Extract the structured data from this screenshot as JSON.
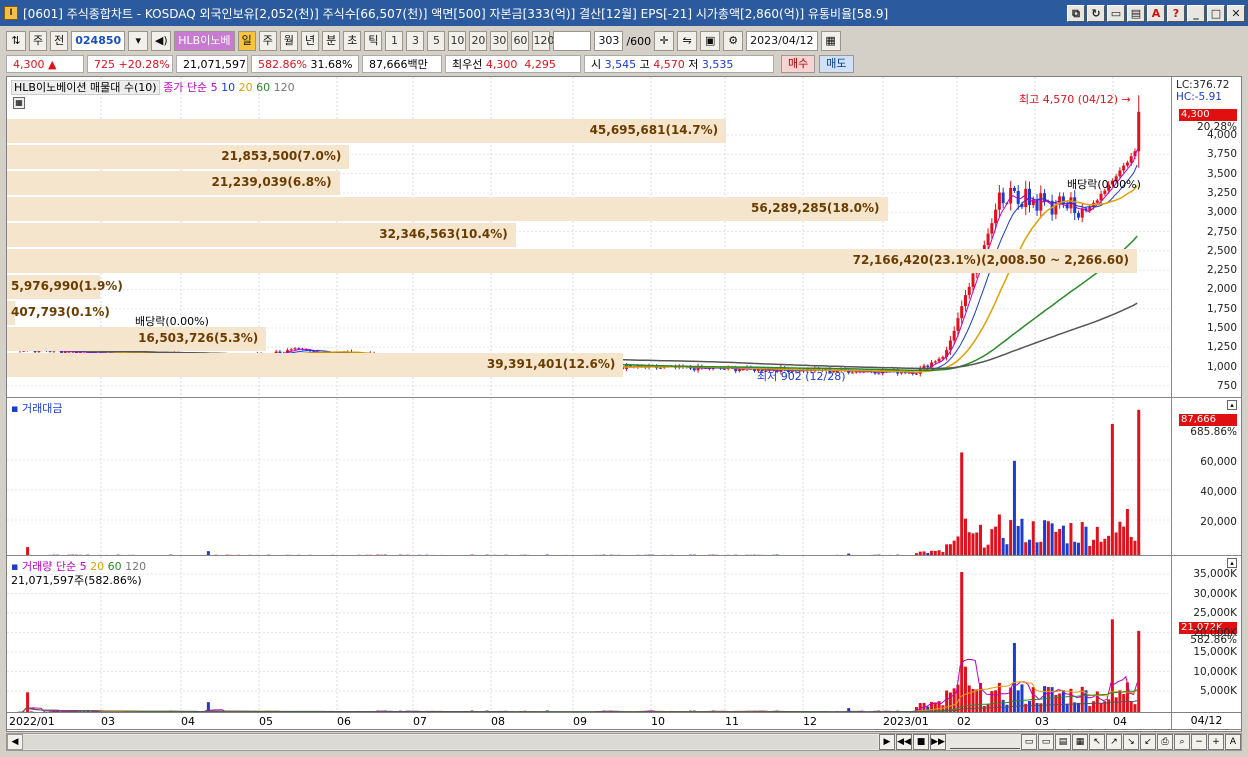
{
  "window": {
    "title": "[0601] 주식종합차트 - KOSDAQ 외국인보유[2,052(천)] 주식수[66,507(천)] 액면[500] 자본금[333(억)] 결산[12월] EPS[-21] 시가총액[2,860(억)] 유통비율[58.9]"
  },
  "toolbar": {
    "period_options": [
      "주",
      "전"
    ],
    "code": "024850",
    "stock_name": "HLB이노베",
    "timeframes": [
      "일",
      "주",
      "월",
      "년",
      "분",
      "초",
      "틱"
    ],
    "intervals": [
      "1",
      "3",
      "5",
      "10",
      "20",
      "30",
      "60",
      "120"
    ],
    "count": "303",
    "count_total": "/600",
    "date": "2023/04/12"
  },
  "quote": {
    "price": "4,300",
    "change": "725",
    "change_pct": "+20.28%",
    "volume": "21,071,597",
    "volume_ratio": "582.86%",
    "turnover": "31.68%",
    "amount": "87,666백만",
    "best_bid_label": "최우선",
    "best_ask": "4,300",
    "best_bid": "4,295",
    "open_label": "시",
    "open": "3,545",
    "high_label": "고",
    "high": "4,570",
    "low_label": "저",
    "low": "3,535",
    "buy_label": "매수",
    "sell_label": "매도"
  },
  "price_pane": {
    "legend_name": "HLB이노베이션 매물대 수(10)",
    "legend_ma": "종가 단순",
    "ma_periods": [
      "5",
      "10",
      "20",
      "60",
      "120"
    ],
    "ma_colors": [
      "#c000c0",
      "#1c3ccf",
      "#e0a000",
      "#2a8a2a",
      "#555555"
    ],
    "lc": "LC:376.72",
    "hc": "HC:-5.91",
    "high_marker": "최고 4,570 (04/12)",
    "low_marker": "최저 902 (12/28)",
    "dividend_label": "배당락(0.00%)",
    "current_price_badge": "4,300",
    "current_change_badge": "20.28%",
    "price_ticks": [
      "4,000",
      "3,750",
      "3,500",
      "3,250",
      "3,000",
      "2,750",
      "2,500",
      "2,250",
      "2,000",
      "1,750",
      "1,500",
      "1,250",
      "1,000",
      "750"
    ],
    "volume_profile": [
      {
        "label": "45,695,681(14.7%)",
        "pct": 14.7
      },
      {
        "label": "21,853,500(7.0%)",
        "pct": 7.0
      },
      {
        "label": "21,239,039(6.8%)",
        "pct": 6.8
      },
      {
        "label": "56,289,285(18.0%)",
        "pct": 18.0
      },
      {
        "label": "32,346,563(10.4%)",
        "pct": 10.4
      },
      {
        "label": "72,166,420(23.1%)(2,008.50 ~ 2,266.60)",
        "pct": 23.1
      },
      {
        "label": "5,976,990(1.9%)",
        "pct": 1.9
      },
      {
        "label": "407,793(0.1%)",
        "pct": 0.1
      },
      {
        "label": "16,503,726(5.3%)",
        "pct": 5.3
      },
      {
        "label": "39,391,401(12.6%)",
        "pct": 12.6
      }
    ]
  },
  "amount_pane": {
    "legend": "거래대금",
    "badge_value": "87,666",
    "badge_pct": "685.86%",
    "ticks": [
      "60,000",
      "40,000",
      "20,000"
    ]
  },
  "volume_pane": {
    "legend_name": "거래량",
    "legend_ma": "단순",
    "ma_periods": [
      "5",
      "20",
      "60",
      "120"
    ],
    "current_volume": "21,071,597주(582.86%)",
    "badge_value": "21,072K",
    "badge_pct": "582.86%",
    "ticks": [
      "35,000K",
      "30,000K",
      "25,000K",
      "20,000K",
      "15,000K",
      "10,000K",
      "5,000K"
    ]
  },
  "date_axis": {
    "labels": [
      "2022/01",
      "03",
      "04",
      "05",
      "06",
      "07",
      "08",
      "09",
      "10",
      "11",
      "12",
      "2023/01",
      "02",
      "03",
      "04"
    ],
    "current": "04/12"
  },
  "chart_data": {
    "type": "candlestick",
    "title": "HLB이노베이션",
    "x_range": [
      "2022/01",
      "2023/04/12"
    ],
    "ylim": [
      750,
      4570
    ],
    "high": {
      "date": "04/12",
      "value": 4570
    },
    "low": {
      "date": "12/28",
      "value": 902
    },
    "last": 4300
  }
}
